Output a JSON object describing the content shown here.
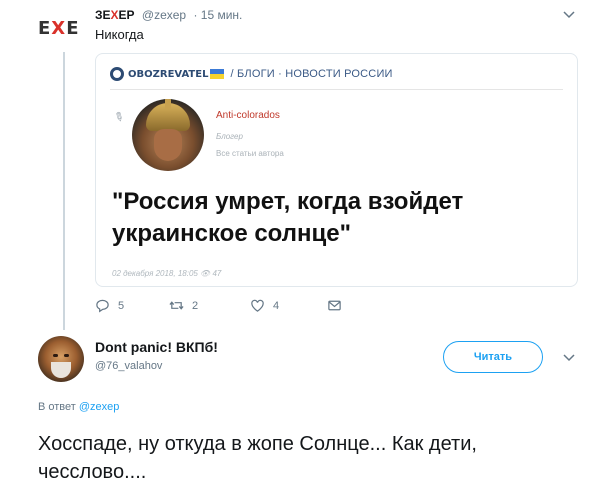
{
  "top_tweet": {
    "logo": {
      "left": "E",
      "x": "X",
      "right": "E"
    },
    "display_name": {
      "pre": "ЗЕ",
      "x": "Х",
      "post": "ЕР"
    },
    "handle": "@zexep",
    "time": "· 15 мин.",
    "text": "Никогда",
    "card": {
      "brand": "OBOZREVATEL",
      "breadcrumb": "/ БЛОГИ · НОВОСТИ РОССИИ",
      "author": "Anti-colorados",
      "author_role": "Блогер",
      "author_all": "Все статьи автора",
      "headline": "\"Россия умрет, когда взойдет украинское солнце\"",
      "meta": "02 декабря 2018, 18:05  👁 47"
    },
    "actions": {
      "reply_count": "5",
      "retweet_count": "2",
      "like_count": "4"
    }
  },
  "reply_tweet": {
    "display_name": "Dont panic! ВКПб!",
    "handle": "@76_valahov",
    "follow_label": "Читать",
    "reply_to_prefix": "В ответ ",
    "reply_to_handle": "@zexep",
    "text": "Хосспаде, ну откуда в жопе Солнце... Как дети, чесслово...."
  },
  "colors": {
    "accent": "#1da1f2",
    "logo_x": "#d9312a",
    "muted": "#657786"
  },
  "icons": [
    "chevron-down-icon",
    "reply-icon",
    "retweet-icon",
    "like-icon",
    "dm-icon",
    "pen-icon",
    "eye-icon"
  ]
}
